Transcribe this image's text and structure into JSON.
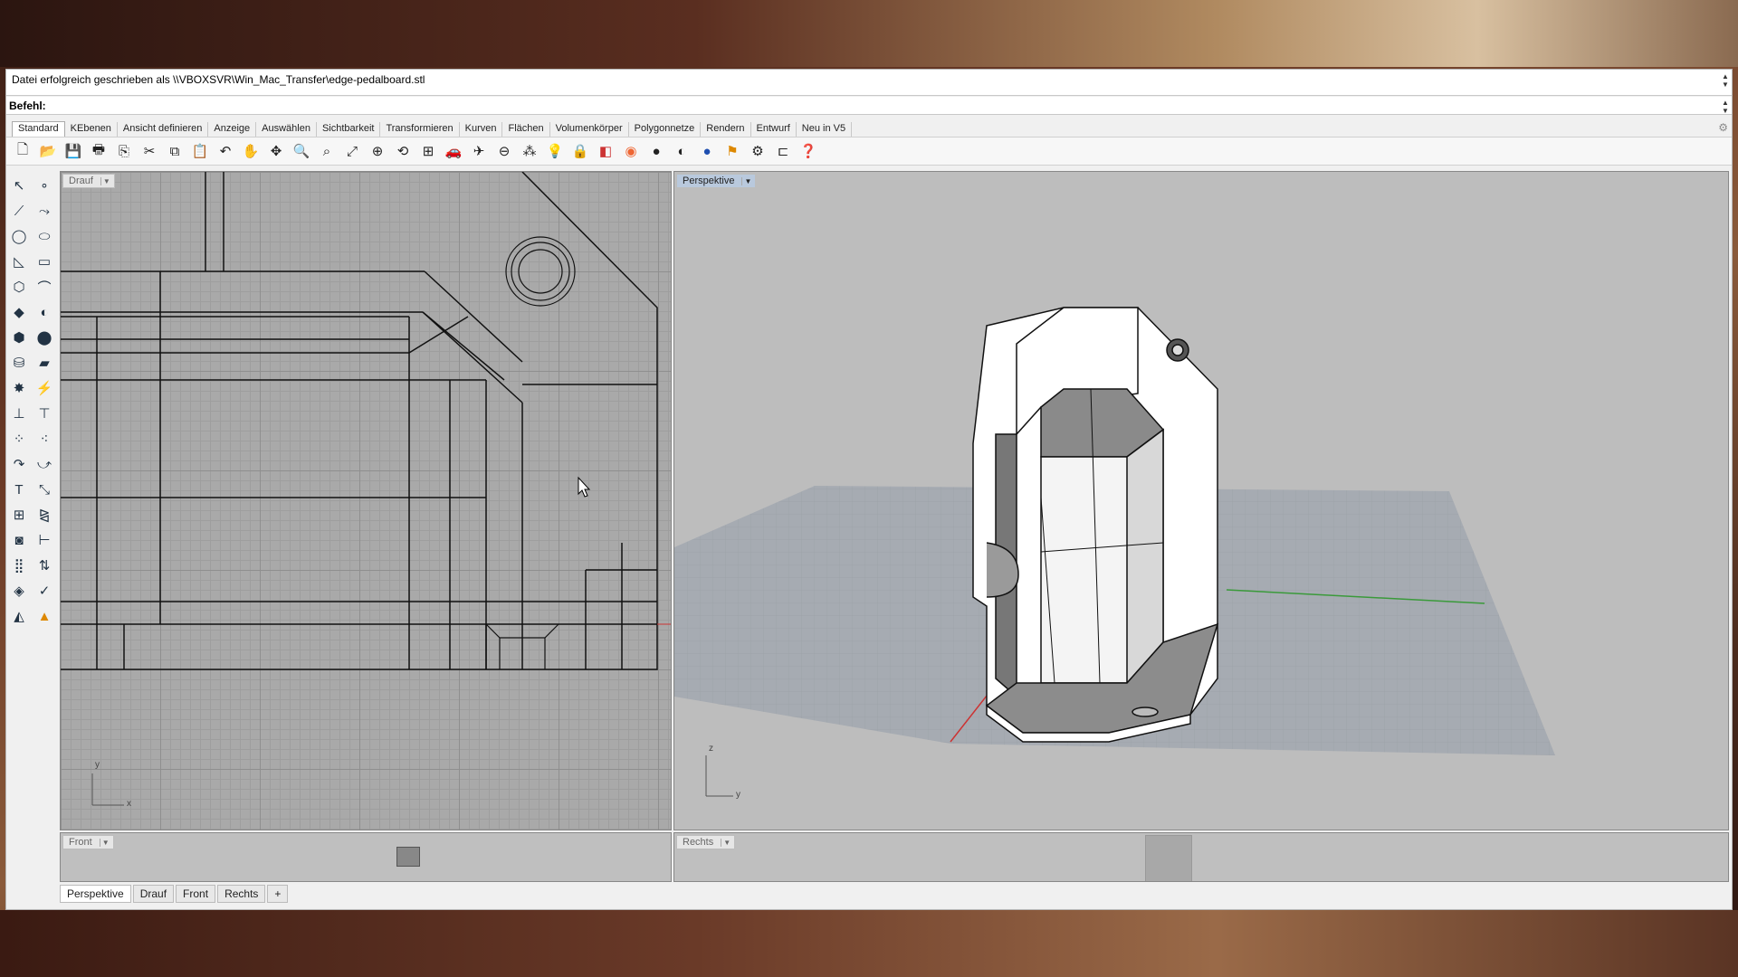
{
  "command_history": {
    "text": "Datei erfolgreich geschrieben als \\\\VBOXSVR\\Win_Mac_Transfer\\edge-pedalboard.stl"
  },
  "command_prompt": {
    "label": "Befehl:"
  },
  "command_tabs": [
    {
      "label": "Standard",
      "active": true
    },
    {
      "label": "KEbenen"
    },
    {
      "label": "Ansicht definieren"
    },
    {
      "label": "Anzeige"
    },
    {
      "label": "Auswählen"
    },
    {
      "label": "Sichtbarkeit"
    },
    {
      "label": "Transformieren"
    },
    {
      "label": "Kurven"
    },
    {
      "label": "Flächen"
    },
    {
      "label": "Volumenkörper"
    },
    {
      "label": "Polygonnetze"
    },
    {
      "label": "Rendern"
    },
    {
      "label": "Entwurf"
    },
    {
      "label": "Neu in V5"
    }
  ],
  "viewports": {
    "top": {
      "title": "Drauf",
      "axis_x": "x",
      "axis_y": "y"
    },
    "perspective": {
      "title": "Perspektive",
      "axis_y": "y",
      "axis_z": "z"
    },
    "front": {
      "title": "Front"
    },
    "right": {
      "title": "Rechts"
    }
  },
  "viewport_tabs": [
    {
      "label": "Perspektive",
      "active": true
    },
    {
      "label": "Drauf"
    },
    {
      "label": "Front"
    },
    {
      "label": "Rechts"
    }
  ],
  "add_tab_symbol": "+"
}
